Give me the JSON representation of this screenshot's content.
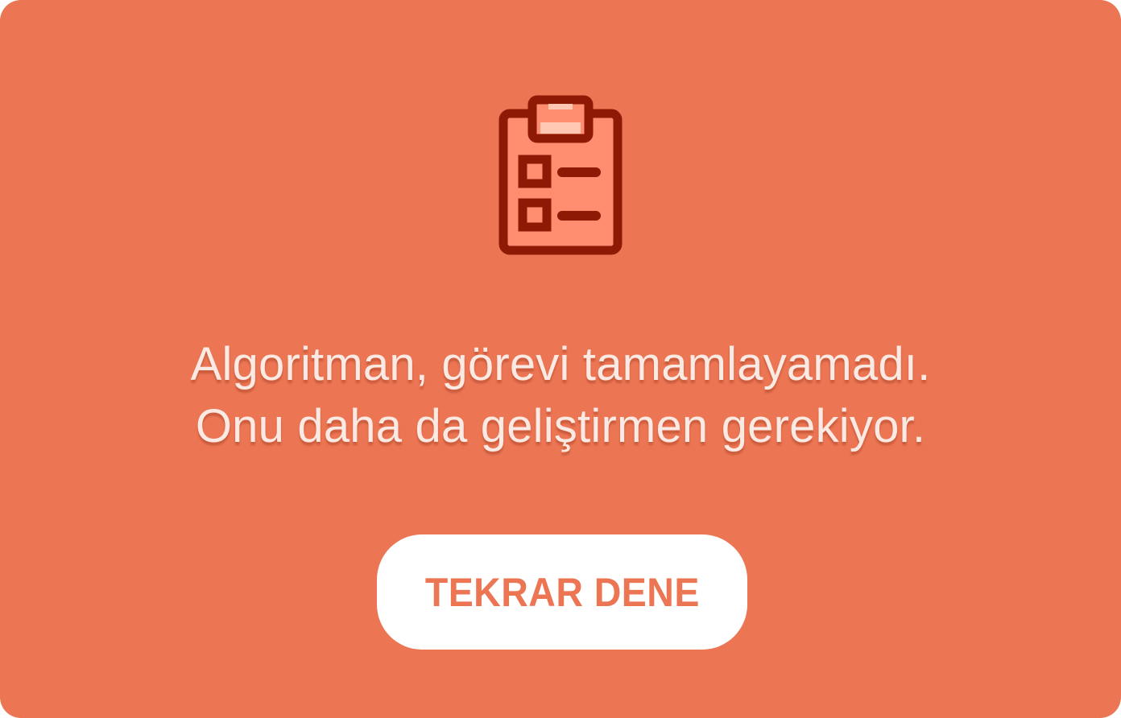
{
  "dialog": {
    "icon": "clipboard-checklist-icon",
    "message_lines": [
      "Algoritman, görevi tamamlayamadı.",
      "Onu daha da geliştirmen gerekiyor."
    ],
    "retry_label": "TEKRAR DENE"
  },
  "colors": {
    "background": "#EC7553",
    "icon_stroke": "#8E1A05",
    "icon_fill": "#FF8E70",
    "icon_highlight": "#FFC8B5",
    "message_text": "#FBEAE3",
    "button_background": "#FFFFFF",
    "button_text": "#EC7553"
  }
}
